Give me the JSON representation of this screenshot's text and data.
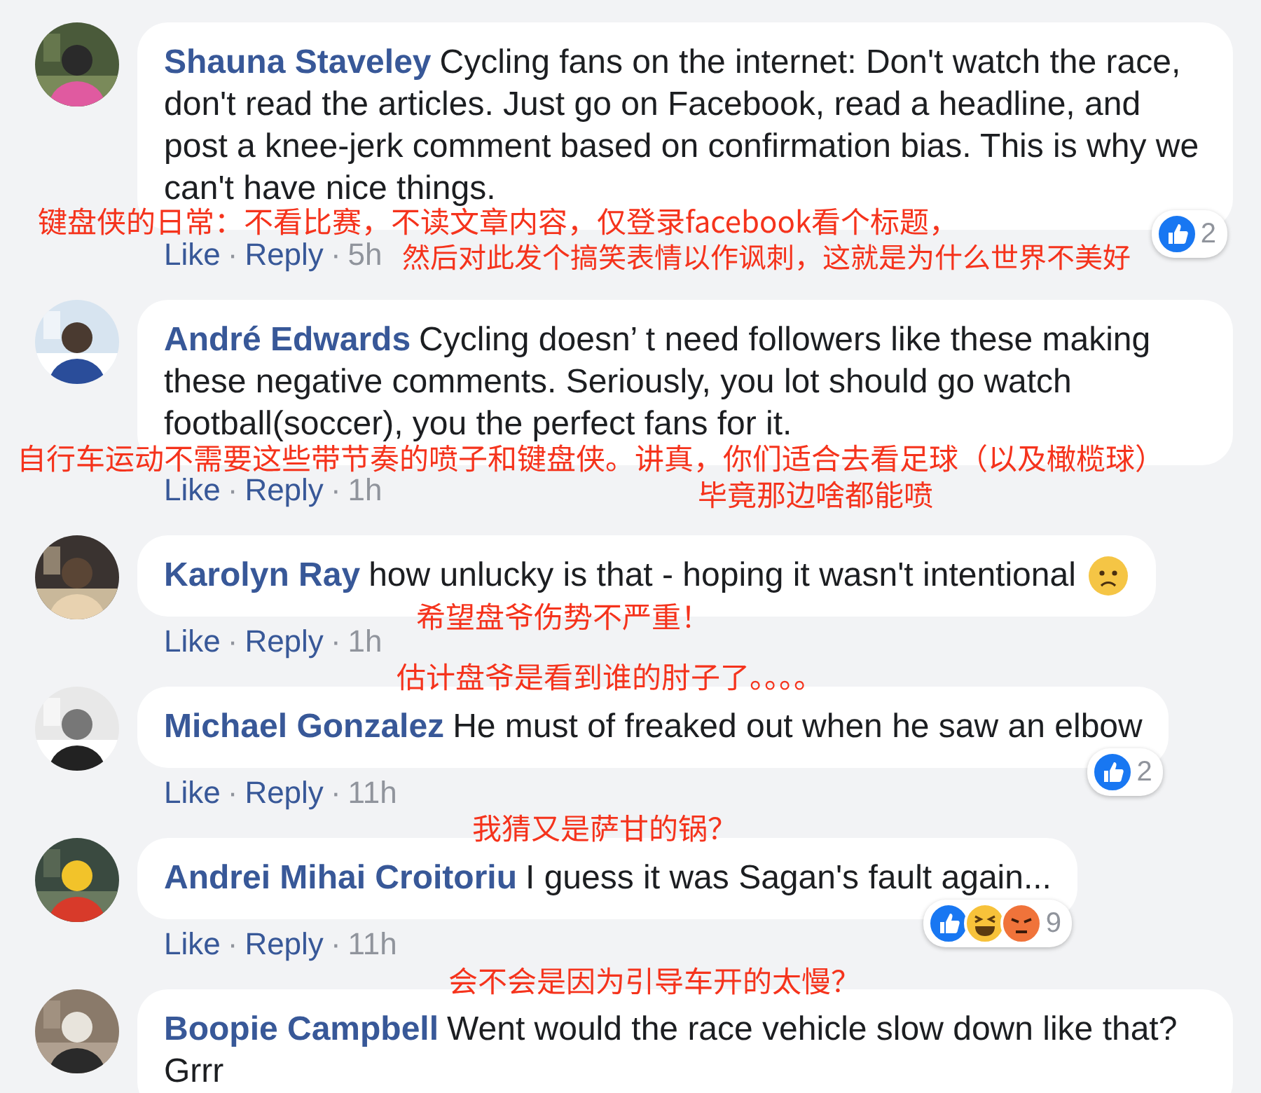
{
  "separator": "·",
  "comments": [
    {
      "author": "Shauna Staveley",
      "text": "Cycling fans on the internet: Don't watch the race, don't read the articles. Just go on Facebook, read a headline, and post a knee-jerk comment based on confirmation bias. This is why we can't have nice things.",
      "actions": [
        "Like",
        "Reply",
        "5h"
      ],
      "reactions": {
        "icons": [
          {
            "kind": "like"
          }
        ],
        "count": "2"
      }
    },
    {
      "author": "André Edwards",
      "text": "Cycling doesn’ t need followers like these making these negative comments. Seriously, you lot should go watch football(soccer), you the perfect fans for it.",
      "actions": [
        "Like",
        "Reply",
        "1h"
      ]
    },
    {
      "author": "Karolyn Ray",
      "text": "how unlucky is that - hoping it wasn't intentional",
      "emoji": {
        "kind": "worried"
      },
      "actions": [
        "Like",
        "Reply",
        "1h"
      ]
    },
    {
      "author": "Michael Gonzalez",
      "text": "He must of freaked out when he saw an elbow",
      "actions": [
        "Like",
        "Reply",
        "11h"
      ],
      "reactions": {
        "icons": [
          {
            "kind": "like"
          }
        ],
        "count": "2"
      }
    },
    {
      "author": "Andrei Mihai Croitoriu",
      "text": "I guess it was Sagan's fault again...",
      "actions": [
        "Like",
        "Reply",
        "11h"
      ],
      "reactions": {
        "icons": [
          {
            "kind": "like"
          },
          {
            "kind": "haha"
          },
          {
            "kind": "angry"
          }
        ],
        "count": "9"
      }
    },
    {
      "author": "Boopie Campbell",
      "text": "Went would the race vehicle slow down like that? Grrr"
    }
  ],
  "annotations": [
    "键盘侠的日常：不看比赛，不读文章内容，仅登录facebook看个标题，",
    "然后对此发个搞笑表情以作讽刺，这就是为什么世界不美好",
    "自行车运动不需要这些带节奏的喷子和键盘侠。讲真，你们适合去看足球（以及橄榄球）",
    "毕竟那边啥都能喷",
    "希望盘爷伤势不严重！",
    "估计盘爷是看到谁的肘子了。。。。",
    "我猜又是萨甘的锅？",
    "会不会是因为引导车开的太慢？"
  ]
}
